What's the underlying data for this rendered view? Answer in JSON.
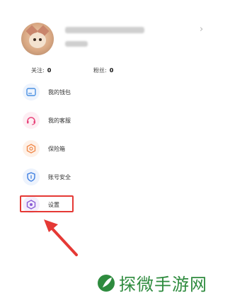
{
  "profile": {
    "chevron": "›"
  },
  "stats": {
    "follow_label": "关注:",
    "follow_count": "0",
    "fans_label": "粉丝:",
    "fans_count": "0"
  },
  "menu": [
    {
      "label": "我的钱包",
      "icon": "wallet-icon",
      "color": "#4a90e2"
    },
    {
      "label": "我的客服",
      "icon": "headset-icon",
      "color": "#e8447a"
    },
    {
      "label": "保险箱",
      "icon": "safe-box-icon",
      "color": "#f08a4b"
    },
    {
      "label": "账号安全",
      "icon": "shield-icon",
      "color": "#3f7fe0"
    },
    {
      "label": "设置",
      "icon": "settings-icon",
      "color": "#8a5cd6"
    }
  ],
  "colors": {
    "highlight": "#e53935",
    "watermark": "#2e8b3e"
  },
  "watermark": {
    "text": "探微手游网"
  }
}
